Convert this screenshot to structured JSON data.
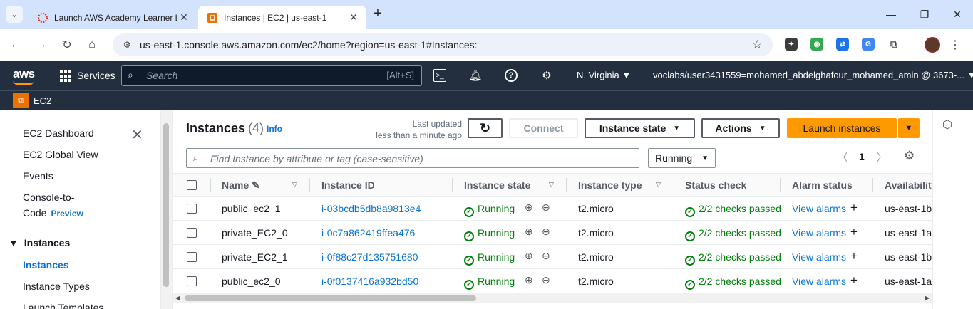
{
  "browser": {
    "tabs": [
      {
        "title": "Launch AWS Academy Learner Lab",
        "active": false
      },
      {
        "title": "Instances | EC2 | us-east-1",
        "active": true
      }
    ],
    "url": "us-east-1.console.aws.amazon.com/ec2/home?region=us-east-1#Instances:"
  },
  "aws": {
    "logo": "aws",
    "services_label": "Services",
    "search_placeholder": "Search",
    "search_shortcut": "[Alt+S]",
    "region": "N. Virginia",
    "account": "voclabs/user3431559=mohamed_abdelghafour_mohamed_amin @ 3673-...",
    "service_name": "EC2"
  },
  "sidebar": {
    "items": [
      "EC2 Dashboard",
      "EC2 Global View",
      "Events",
      "Console-to-",
      "Code"
    ],
    "preview_badge": "Preview",
    "section": "Instances",
    "section_items": [
      "Instances",
      "Instance Types",
      "Launch Templates"
    ]
  },
  "main": {
    "title": "Instances",
    "count": "(4)",
    "info": "Info",
    "last_updated_line1": "Last updated",
    "last_updated_line2": "less than a minute ago",
    "connect": "Connect",
    "instance_state": "Instance state",
    "actions": "Actions",
    "launch": "Launch instances",
    "search_placeholder": "Find Instance by attribute or tag (case-sensitive)",
    "filter_value": "Running",
    "page_number": "1"
  },
  "table": {
    "columns": [
      "Name",
      "Instance ID",
      "Instance state",
      "Instance type",
      "Status check",
      "Alarm status",
      "Availability"
    ],
    "rows": [
      {
        "name": "public_ec2_1",
        "id": "i-03bcdb5db8a9813e4",
        "state": "Running",
        "type": "t2.micro",
        "status": "2/2 checks passed",
        "alarm": "View alarms",
        "az": "us-east-1b"
      },
      {
        "name": "private_EC2_0",
        "id": "i-0c7a862419ffea476",
        "state": "Running",
        "type": "t2.micro",
        "status": "2/2 checks passed",
        "alarm": "View alarms",
        "az": "us-east-1a"
      },
      {
        "name": "private_EC2_1",
        "id": "i-0f88c27d135751680",
        "state": "Running",
        "type": "t2.micro",
        "status": "2/2 checks passed",
        "alarm": "View alarms",
        "az": "us-east-1b"
      },
      {
        "name": "public_ec2_0",
        "id": "i-0f0137416a932bd50",
        "state": "Running",
        "type": "t2.micro",
        "status": "2/2 checks passed",
        "alarm": "View alarms",
        "az": "us-east-1a"
      }
    ]
  },
  "colors": {
    "aws_header": "#232f3e",
    "accent": "#ff9900",
    "link": "#0972d3",
    "success": "#037f0c"
  }
}
